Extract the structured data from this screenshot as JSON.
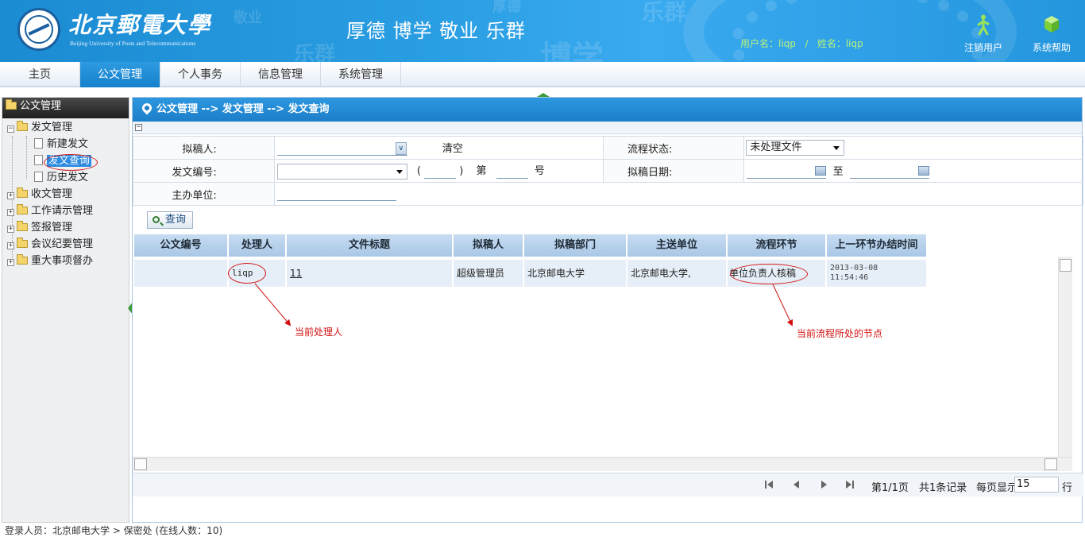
{
  "header": {
    "logo_cn": "北京郵電大學",
    "logo_en": "Beijing University of Posts and Telecommunications",
    "motto": "厚德  博学  敬业  乐群",
    "user_info": "用户名：liqp   /   姓名：liqp",
    "logout_label": "注销用户",
    "help_label": "系统帮助",
    "logout_icon": "person-walk-icon",
    "help_icon": "cube-icon"
  },
  "nav": {
    "items": [
      {
        "label": "主页"
      },
      {
        "label": "公文管理"
      },
      {
        "label": "个人事务"
      },
      {
        "label": "信息管理"
      },
      {
        "label": "系统管理"
      }
    ]
  },
  "sidebar": {
    "title": "公文管理",
    "tree": [
      {
        "label": "发文管理",
        "expanded": true
      },
      {
        "label": "新建发文"
      },
      {
        "label": "发文查询",
        "selected": true
      },
      {
        "label": "历史发文"
      },
      {
        "label": "收文管理"
      },
      {
        "label": "工作请示管理"
      },
      {
        "label": "签报管理"
      },
      {
        "label": "会议纪要管理"
      },
      {
        "label": "重大事项督办"
      }
    ]
  },
  "breadcrumb": "公文管理 --> 发文管理 --> 发文查询",
  "form": {
    "drafter_label": "拟稿人:",
    "drafter_value": "",
    "clear_label": "清空",
    "status_label": "流程状态:",
    "status_value": "未处理文件",
    "docno_label": "发文编号:",
    "docno_value": "",
    "paren_open": "(",
    "paren_close": ")",
    "di_label": "第",
    "hao_label": "号",
    "date_label": "拟稿日期:",
    "date_from": "",
    "to_label": "至",
    "date_to": "",
    "dept_label": "主办单位:",
    "dept_value": ""
  },
  "query_button": "查询",
  "grid": {
    "columns": [
      "公文编号",
      "处理人",
      "文件标题",
      "拟稿人",
      "拟稿部门",
      "主送单位",
      "流程环节",
      "上一环节办结时间"
    ],
    "rows": [
      {
        "doc_no": "",
        "handler": "liqp",
        "title": "11",
        "drafter": "超级管理员",
        "dept": "北京邮电大学",
        "recipient": "北京邮电大学,",
        "step": "单位负责人核稿",
        "prev_time_date": "2013-03-08",
        "prev_time_clock": "11:54:46"
      }
    ]
  },
  "annotations": {
    "handler_note": "当前处理人",
    "step_note": "当前流程所处的节点",
    "color": "#d21010"
  },
  "pager": {
    "page_info": "第1/1页",
    "total": "共1条记录",
    "per_page_label": "每页显示",
    "per_page_value": "15",
    "unit": "行"
  },
  "footer": "登录人员：北京邮电大学 > 保密处  (在线人数：10)",
  "colors": {
    "brand_blue": "#1d7ec9",
    "nav_active": "#1581cc",
    "user_info": "#b6f27a"
  }
}
